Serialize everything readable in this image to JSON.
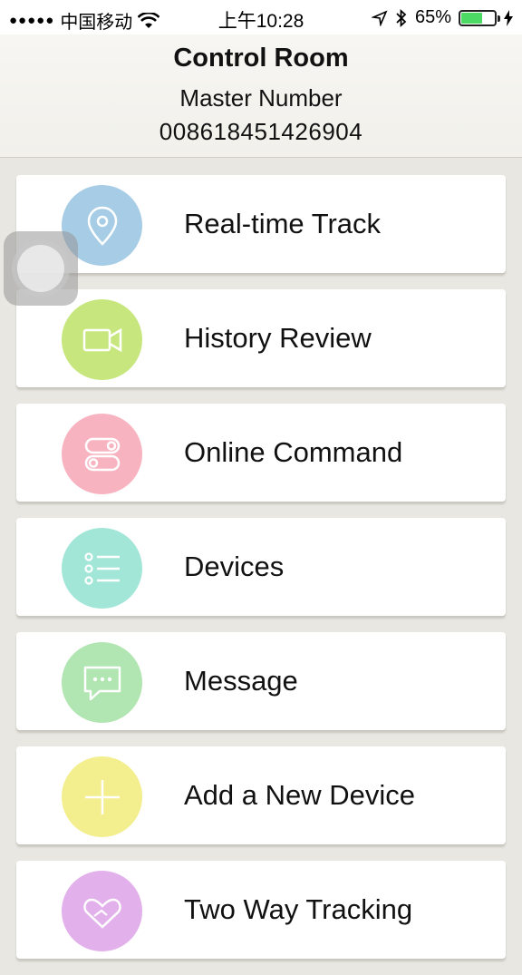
{
  "status_bar": {
    "signal_dots": "●●●●●",
    "carrier": "中国移动",
    "time": "上午10:28",
    "battery_percent": "65%",
    "battery_level": 0.65,
    "battery_color": "#4cd964"
  },
  "header": {
    "title": "Control Room",
    "subtitle": "Master Number",
    "number": "008618451426904"
  },
  "menu": {
    "items": [
      {
        "label": "Real-time Track",
        "icon": "location-pin-icon",
        "color": "#a7cde6"
      },
      {
        "label": "History Review",
        "icon": "video-camera-icon",
        "color": "#c7e77e"
      },
      {
        "label": "Online Command",
        "icon": "toggle-switches-icon",
        "color": "#f8b3c1"
      },
      {
        "label": "Devices",
        "icon": "list-icon",
        "color": "#a2e6d8"
      },
      {
        "label": "Message",
        "icon": "chat-bubble-icon",
        "color": "#b1e5b1"
      },
      {
        "label": "Add a New Device",
        "icon": "plus-icon",
        "color": "#f3ee8e"
      },
      {
        "label": "Two Way Tracking",
        "icon": "handshake-icon",
        "color": "#e2b0ea"
      }
    ]
  }
}
